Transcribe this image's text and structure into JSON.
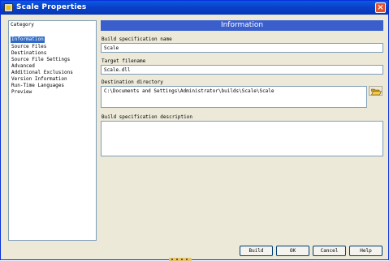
{
  "window": {
    "title": "Scale Properties"
  },
  "category": {
    "header": "Category",
    "items": [
      "Information",
      "Source Files",
      "Destinations",
      "Source File Settings",
      "Advanced",
      "Additional Exclusions",
      "Version Information",
      "Run-Time Languages",
      "Preview"
    ],
    "selected": "Information"
  },
  "info": {
    "header": "Information",
    "build_spec_name_label": "Build specification name",
    "build_spec_name_value": "Scale",
    "target_filename_label": "Target filename",
    "target_filename_value": "Scale.dll",
    "destination_dir_label": "Destination directory",
    "destination_dir_value": "C:\\Documents and Settings\\Administrator\\builds\\Scale\\Scale",
    "description_label": "Build specification description",
    "description_value": ""
  },
  "buttons": {
    "build": "Build",
    "ok": "OK",
    "cancel": "Cancel",
    "help": "Help"
  },
  "colors": {
    "titlebar": "#0a4fd8",
    "info_header": "#3a5fcd",
    "selection": "#316ac5",
    "dialog_bg": "#ece9d8"
  },
  "icons": {
    "app": "app-icon",
    "close": "close-icon",
    "browse": "folder-open-icon"
  }
}
